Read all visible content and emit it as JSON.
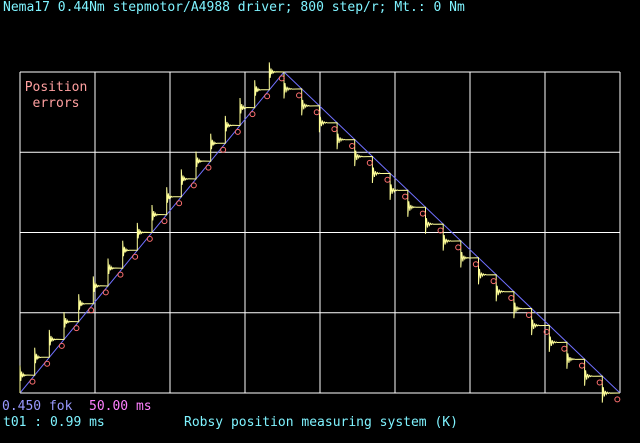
{
  "header": {
    "title": "Nema17 0.44Nm stepmotor/A4988 driver; 800 step/r; Mt.: 0 Nm"
  },
  "plot_label": {
    "line1": "Position",
    "line2": "errors"
  },
  "footer": {
    "scale": "0.450 fok",
    "timebase": "50.00 ms",
    "cursor_time": "t01 : 0.99 ms",
    "system_name": "Robsy position measuring system (K)"
  },
  "colors": {
    "grid": "#ffffff",
    "measured": "#ffff99",
    "reference": "#7070ff",
    "markers": "#ff7070",
    "text_cyan": "#7ff3ff",
    "text_pink": "#ff80ff",
    "text_blue": "#9a9aff"
  },
  "chart_data": {
    "type": "line",
    "grid": true,
    "x_divisions": 8,
    "y_divisions": 4,
    "x_unit_per_div": "50.00 ms",
    "y_unit_per_div": "0.450 fok",
    "series": [
      {
        "kind": "reference",
        "x": [
          0,
          0.44,
          1
        ],
        "y": [
          0,
          1,
          0
        ]
      },
      {
        "kind": "measured",
        "steps_up": 18,
        "steps_down": 19,
        "peak_x": 0.44
      }
    ]
  }
}
